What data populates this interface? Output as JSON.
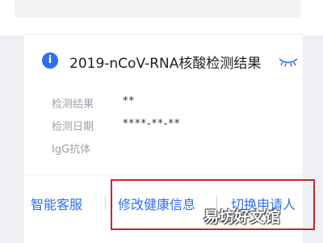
{
  "result_card": {
    "title": "2019-nCoV-RNA核酸检测结果",
    "rows": [
      {
        "label": "检测结果",
        "value": "**"
      },
      {
        "label": "检测日期",
        "value": "****-**-**"
      },
      {
        "label": "IgG抗体",
        "value": ""
      }
    ]
  },
  "actions": {
    "customer_service": "智能客服",
    "edit_health_info": "修改健康信息",
    "switch_applicant": "切换申请人"
  },
  "watermark": "易坊好文馆",
  "colors": {
    "accent": "#2b6ff2",
    "highlight": "#c8262a"
  }
}
